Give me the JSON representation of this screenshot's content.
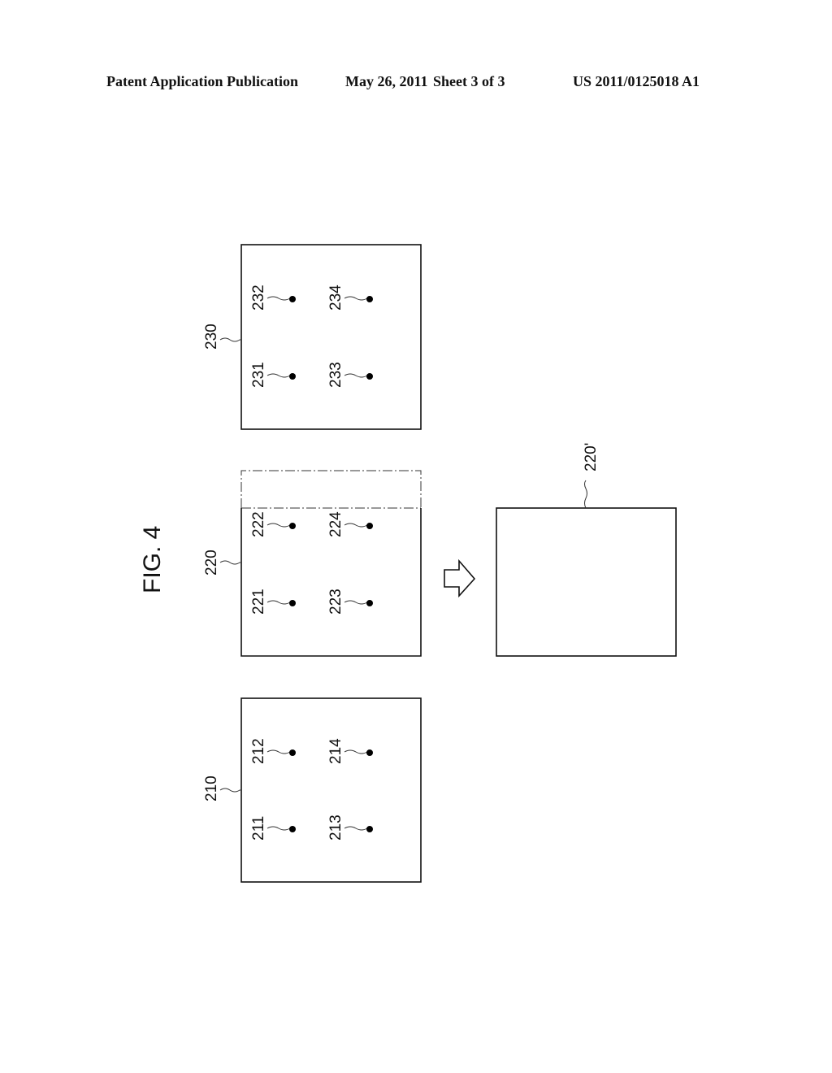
{
  "header": {
    "publication": "Patent Application Publication",
    "date": "May 26, 2011",
    "sheet": "Sheet 3 of 3",
    "number": "US 2011/0125018 A1"
  },
  "figure": {
    "title": "FIG. 4",
    "panels": [
      {
        "id": "230",
        "points": [
          "231",
          "232",
          "233",
          "234"
        ]
      },
      {
        "id": "220",
        "points": [
          "221",
          "222",
          "223",
          "224"
        ]
      },
      {
        "id": "210",
        "points": [
          "211",
          "212",
          "213",
          "214"
        ]
      }
    ],
    "result_panel": {
      "id": "220'"
    },
    "arrow": "right-arrow"
  }
}
